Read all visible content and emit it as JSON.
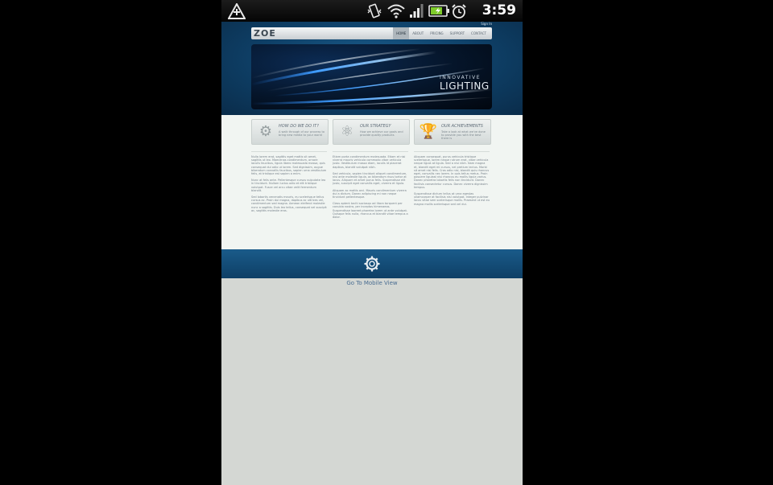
{
  "status_bar": {
    "clock": "3:59",
    "icons": [
      "app-notification-icon",
      "vibrate-icon",
      "wifi-icon",
      "signal-icon",
      "battery-icon",
      "alarm-icon"
    ]
  },
  "site": {
    "signin": "Sign In",
    "logo": "ZOE",
    "nav": [
      "HOME",
      "ABOUT",
      "PRICING",
      "SUPPORT",
      "CONTACT"
    ],
    "banner": {
      "line1": "INNOVATIVE",
      "line2": "LIGHTING"
    },
    "features": [
      {
        "title": "HOW DO WE DO IT?",
        "text": "A walk through of our process to bring new media to your world",
        "icon": "gear-icon"
      },
      {
        "title": "OUR STRATEGY",
        "text": "How we achieve our goals and provide quality products",
        "icon": "atom-icon"
      },
      {
        "title": "OUR ACHIEVEMENTS",
        "text": "Take a look at what we've done to provide you with the best there is",
        "icon": "trophy-icon"
      }
    ],
    "columns": [
      [
        "Nulla lorem erat, sagittis eget mattis sit amet, sagittis ut leo. Maecenas condimentum, ornare iaculis faucibus, ligula libero malesuada massa, quis consequat dui odio ut lorem. Sed dignissim, augue bibendum convallis faucibus, sapien urna vestibulum felis, at tristique est sapien a enim.",
        "Nunc at felis ante. Pellentesque cursus vulputate leo in tincidunt. Nullam luctus odio et elit tristique volutpat. Fusce vel arcu vitae velit fermentum blandit.",
        "Sed lobortis venenatis mauris, eu scelerisque tellus cursus ac. Proin dui magna, dapibus ac ultrices vel, condimentum sed magna. Aenean eleifend molestie nunc a sagittis. Duis leo tellus, consequat vel suscipit ac, sagittis molestie eros."
      ],
      [
        "Etiam porta condimentum malesuada. Etiam et nisi viverra mauris vehicula commodo vitae vehicula justo. Vestibulum massa diam, iaculis id placerat dapibus, blandit volutpat nibh.",
        "Sed vehicula, sapien tincidunt aliquet condimentum, nisi ante molestie ligula, ac bibendum risus tortor at lacus. Aliquam et amet purus felis. Suspendisse elit justo, suscipit eget convallis eget, viverra et ligula.",
        "Aliquam ac mattis orci. Mauris condimentum viverra dui a dictum. Donec adipiscing mi non neque tincidunt pellentesque.",
        "Class aptent taciti sociosqu ad litora torquent per conubia nostra, per inceptos himenaeos. Suspendisse laoreet pharetra lorem ut ante volutpat. Quisque felis nulla, rhoncus et blandit vitae tempus a dolor."
      ],
      [
        "Aliquam consequat, purus vehicula tristique scelerisque, lorem neque rutrum erat, vitae vehicula neque ligula at ligula. Sed a nisi nibh. Nam magna et, blandit eget mi cursus, vel pretium lectus. Morbi sit amet nisi felis. Cras odio nisi, blandit quis rhoncus eget, convallis nec lorem. In quis tellus metus. Proin posuere ligulast nisi rhoncus eu mollis ligula varius. Donec pharetra lobortis felis non tincidunt. Donec facilisis consectetur cursus. Donec viverra dignissim tempus.",
        "Suspendisse dictum tellus at urna egestas ullamcorper at facilisis nisl volutpat. Integer pulvinar lacus vitae sem scelerisque mollis. Praesent ut est eu magna mollis scelerisque sed vel dui."
      ]
    ],
    "mobile_link": "Go To Mobile View"
  },
  "colors": {
    "header_blue": "#0e3f66",
    "content_bg": "#f1f5f2",
    "page_bg": "#d4d7d3"
  }
}
